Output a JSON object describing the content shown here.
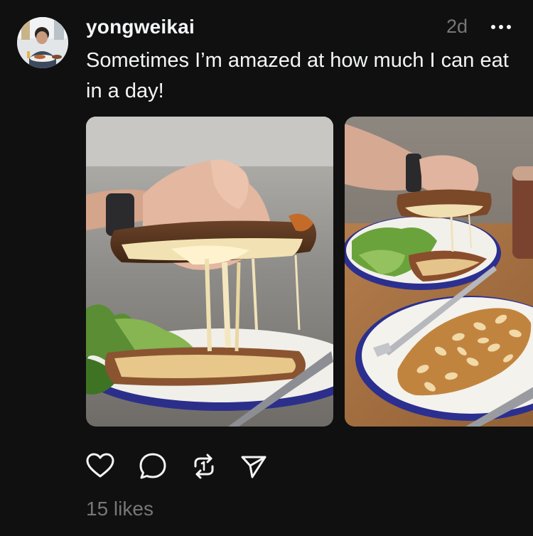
{
  "post": {
    "username": "yongweikai",
    "time": "2d",
    "caption": "Sometimes I’m amazed at how much I can eat in a day!",
    "likes": "15 likes"
  },
  "icons": {
    "more": "more-horizontal-icon",
    "like": "heart-icon",
    "comment": "comment-icon",
    "repost": "repost-icon",
    "share": "send-icon"
  },
  "colors": {
    "background": "#101010",
    "text": "#f3f5f7",
    "secondary_text": "#777777"
  }
}
